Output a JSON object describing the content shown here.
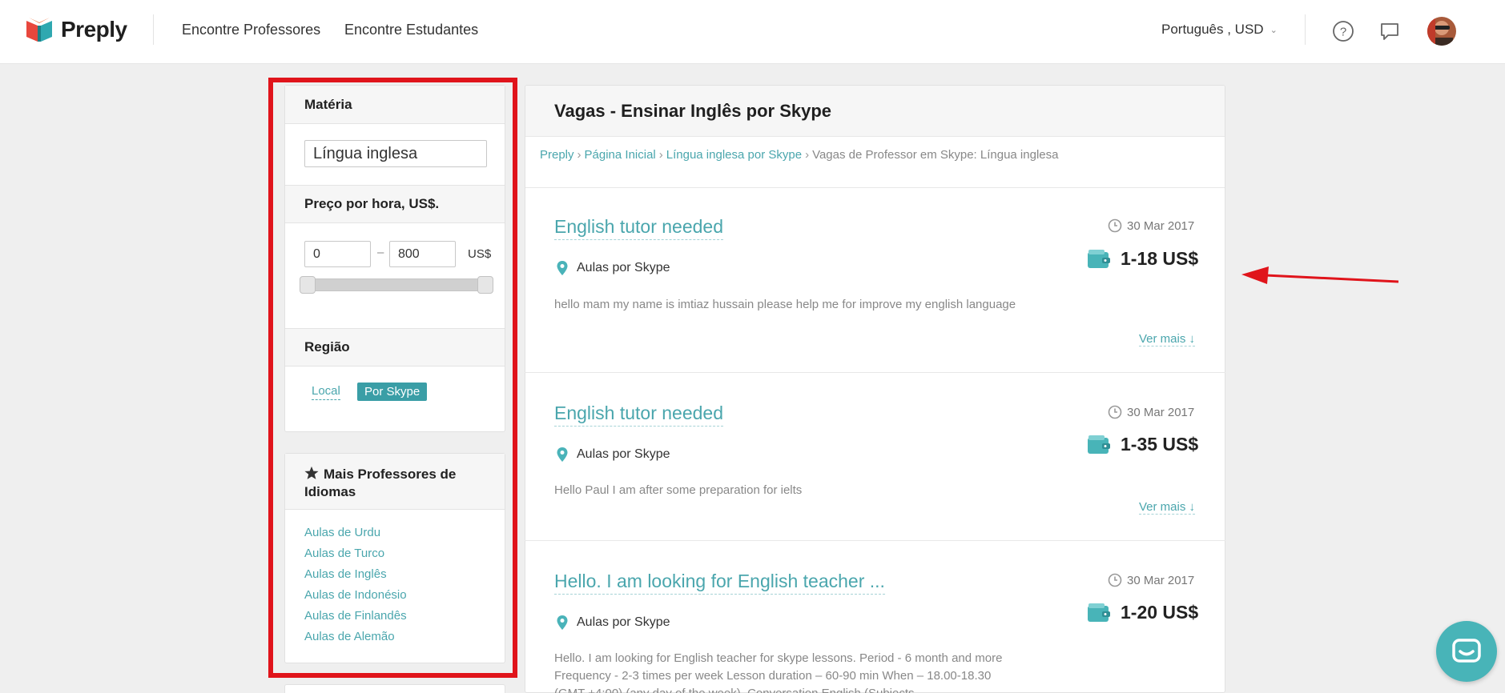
{
  "header": {
    "logo_text": "Preply",
    "nav": [
      "Encontre Professores",
      "Encontre Estudantes"
    ],
    "language_currency": "Português , USD"
  },
  "sidebar": {
    "subject": {
      "title": "Matéria",
      "value": "Língua inglesa"
    },
    "price": {
      "title": "Preço por hora, US$.",
      "min": "0",
      "max": "800",
      "currency": "US$",
      "range_min_fraction": 0,
      "range_max_fraction": 1
    },
    "region": {
      "title": "Região",
      "options": [
        "Local",
        "Por Skype"
      ],
      "selected": "Por Skype"
    },
    "more_teachers": {
      "title_line1": "Mais Professores de",
      "title_line2": "Idiomas",
      "links": [
        "Aulas de Urdu",
        "Aulas de Turco",
        "Aulas de Inglês",
        "Aulas de Indonésio",
        "Aulas de Finlandês",
        "Aulas de Alemão"
      ]
    }
  },
  "main": {
    "title": "Vagas - Ensinar Inglês por Skype",
    "breadcrumb": [
      "Preply",
      "Página Inicial",
      "Língua inglesa por Skype"
    ],
    "breadcrumb_current": "Vagas de Professor em Skype: Língua inglesa",
    "jobs": [
      {
        "title": "English tutor needed",
        "date": "30 Mar 2017",
        "location": "Aulas por Skype",
        "price": "1-18 US$",
        "description": "hello mam my name is imtiaz hussain please help me for improve my english language",
        "more": "Ver mais ↓"
      },
      {
        "title": "English tutor needed",
        "date": "30 Mar 2017",
        "location": "Aulas por Skype",
        "price": "1-35 US$",
        "description": "Hello Paul I am after some preparation for ielts",
        "more": "Ver mais ↓"
      },
      {
        "title": "Hello. I am looking for English teacher ...",
        "date": "30 Mar 2017",
        "location": "Aulas por Skype",
        "price": "1-20 US$",
        "description": "Hello. I am looking for English teacher for skype lessons. Period - 6 month and more Frequency - 2-3 times per week Lesson duration – 60-90 min When – 18.00-18.30 (GMT +4:00) (any day of the week). Conversation English (Subjects -",
        "more": ""
      }
    ]
  },
  "colors": {
    "accent": "#4aa6ad",
    "highlight_red": "#e0141b"
  },
  "icons": [
    "preply-logo-icon",
    "help-icon",
    "chat-icon",
    "clock-icon",
    "location-pin-icon",
    "wallet-icon",
    "star-icon",
    "messenger-icon"
  ]
}
